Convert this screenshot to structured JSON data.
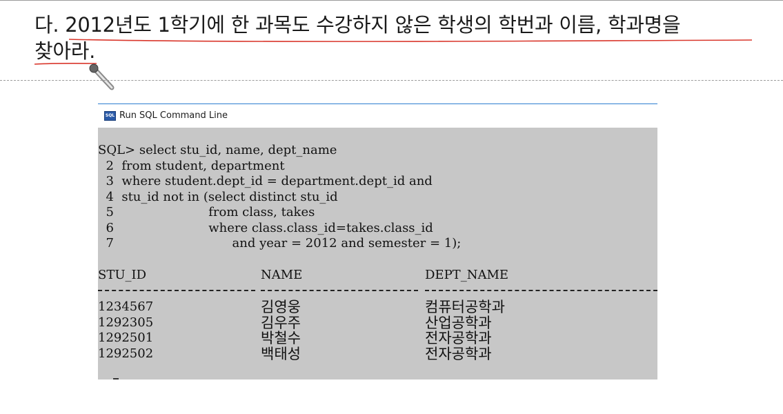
{
  "question": {
    "line1": "다. 2012년도 1학기에 한 과목도 수강하지 않은 학생의 학번과 이름, 학과명을",
    "line2": "찾아라."
  },
  "window": {
    "title": "Run SQL Command Line",
    "icon_name": "sql-command-line-icon",
    "icon_label": "SQL"
  },
  "query": {
    "lines": [
      "SQL> select stu_id, name, dept_name",
      "  2  from student, department",
      "  3  where student.dept_id = department.dept_id and",
      "  4  stu_id not in (select distinct stu_id",
      "  5                        from class, takes",
      "  6                        where class.class_id=takes.class_id",
      "  7                              and year = 2012 and semester = 1);"
    ]
  },
  "result": {
    "columns": [
      "STU_ID",
      "NAME",
      "DEPT_NAME"
    ],
    "rows": [
      [
        "1234567",
        "김영웅",
        "컴퓨터공학과"
      ],
      [
        "1292305",
        "김우주",
        "산업공학과"
      ],
      [
        "1292501",
        "박철수",
        "전자공학과"
      ],
      [
        "1292502",
        "백태성",
        "전자공학과"
      ]
    ]
  },
  "colors": {
    "console_bg": "#c7c7c7",
    "annotation_red": "#d9362b",
    "titlebar_border": "#2b7ccf"
  }
}
